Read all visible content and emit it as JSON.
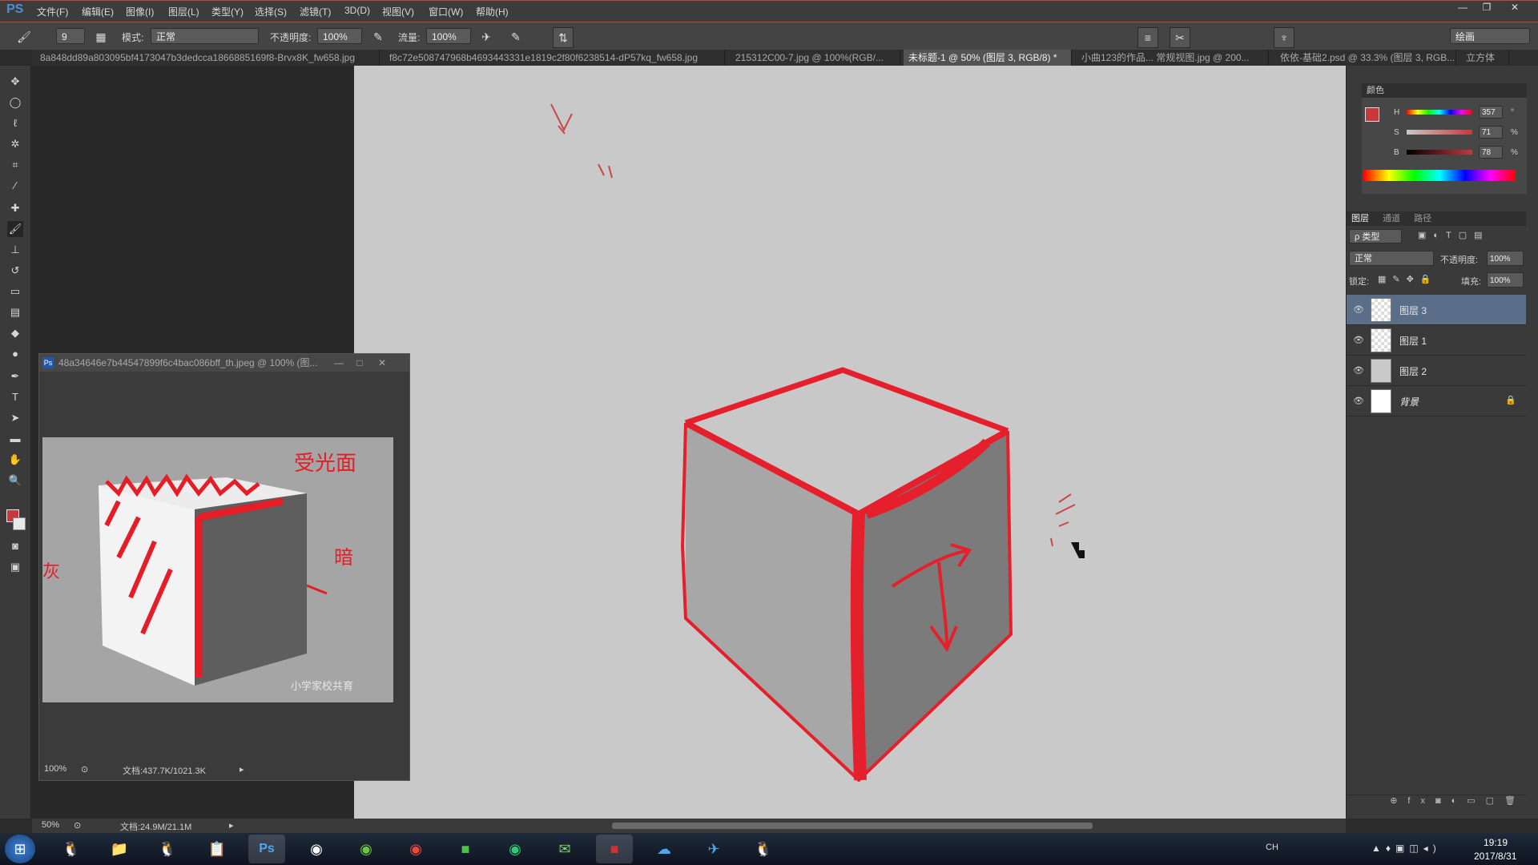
{
  "app": {
    "logo": "PS"
  },
  "menu": [
    "文件(F)",
    "编辑(E)",
    "图像(I)",
    "图层(L)",
    "类型(Y)",
    "选择(S)",
    "滤镜(T)",
    "3D(D)",
    "视图(V)",
    "窗口(W)",
    "帮助(H)"
  ],
  "options": {
    "brush_size": "9",
    "mode_label": "模式:",
    "mode_value": "正常",
    "opacity_label": "不透明度:",
    "opacity_value": "100%",
    "flow_label": "流量:",
    "flow_value": "100%",
    "workspace": "绘画"
  },
  "tabs": [
    {
      "label": "8a848dd89a803095bf4173047b3dedcca1866885169f8-Brvx8K_fw658.jpg",
      "active": false
    },
    {
      "label": "f8c72e508747968b4693443331e1819c2f80f6238514-dP57kq_fw658.jpg",
      "active": false
    },
    {
      "label": "215312C00-7.jpg @ 100%(RGB/...",
      "active": false
    },
    {
      "label": "未标题-1 @ 50% (图层 3, RGB/8) *",
      "active": true
    },
    {
      "label": "小曲123的作品... 常规视图.jpg @ 200...",
      "active": false
    },
    {
      "label": "依依-基础2.psd @ 33.3% (图层 3, RGB...",
      "active": false
    },
    {
      "label": "立方体",
      "active": false
    }
  ],
  "float_window": {
    "title": "48a34646e7b44547899f6c4bac086bff_th.jpeg @ 100% (图...",
    "zoom": "100%",
    "doc_info": "文档:437.7K/1021.3K",
    "annotations": {
      "light": "受光面",
      "dark": "暗",
      "grey": "灰"
    },
    "watermark": "小学家校共育"
  },
  "color_panel": {
    "title": "颜色",
    "h_label": "H",
    "h_value": "357",
    "h_unit": "°",
    "s_label": "S",
    "s_value": "71",
    "s_unit": "%",
    "b_label": "B",
    "b_value": "78",
    "b_unit": "%",
    "fg_color": "#c8373c"
  },
  "layers_panel": {
    "tabs": [
      "图层",
      "通道",
      "路径"
    ],
    "filter_label": "ρ 类型",
    "blend_mode": "正常",
    "opacity_label": "不透明度:",
    "opacity_value": "100%",
    "lock_label": "锁定:",
    "fill_label": "填充:",
    "fill_value": "100%",
    "layers": [
      {
        "name": "图层 3",
        "selected": true
      },
      {
        "name": "图层 1",
        "selected": false
      },
      {
        "name": "图层 2",
        "selected": false
      },
      {
        "name": "背景",
        "selected": false
      }
    ]
  },
  "status": {
    "zoom": "50%",
    "doc_info": "文档:24.9M/21.1M"
  },
  "taskbar": {
    "lang": "CH",
    "time": "19:19",
    "date": "2017/8/31"
  }
}
